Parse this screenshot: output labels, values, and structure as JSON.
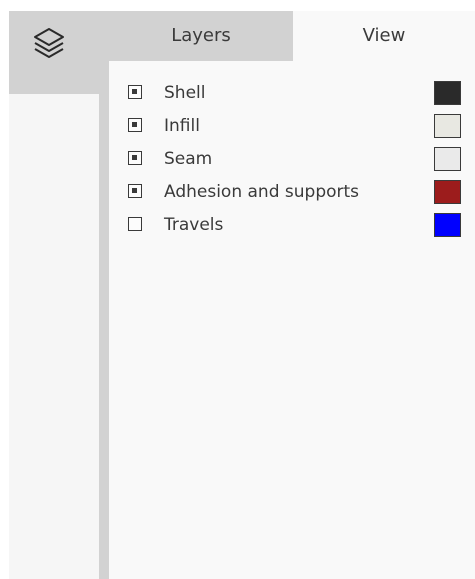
{
  "tabs": [
    {
      "label": "Layers",
      "active": false
    },
    {
      "label": "View",
      "active": true
    }
  ],
  "view_options": [
    {
      "label": "Shell",
      "checked": true,
      "color": "#2a2a2a"
    },
    {
      "label": "Infill",
      "checked": true,
      "color": "#e8e8e2"
    },
    {
      "label": "Seam",
      "checked": true,
      "color": "#eaeaea"
    },
    {
      "label": "Adhesion and supports",
      "checked": true,
      "color": "#9c1c1c"
    },
    {
      "label": "Travels",
      "checked": false,
      "color": "#0000ff"
    }
  ],
  "icons": {
    "side_toggle": "layers-stack-icon"
  }
}
